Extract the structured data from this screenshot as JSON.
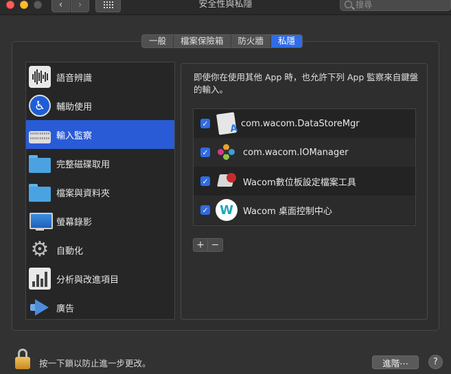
{
  "window": {
    "title": "安全性與私隱",
    "search_placeholder": "搜尋",
    "nav_back_glyph": "‹",
    "nav_forward_glyph": "›"
  },
  "tabs": [
    {
      "label": "一般",
      "active": false
    },
    {
      "label": "檔案保險箱",
      "active": false
    },
    {
      "label": "防火牆",
      "active": false
    },
    {
      "label": "私隱",
      "active": true
    }
  ],
  "sidebar": {
    "items": [
      {
        "label": "語音辨識",
        "icon": "speech-recognition-icon",
        "selected": false
      },
      {
        "label": "輔助使用",
        "icon": "accessibility-icon",
        "selected": false
      },
      {
        "label": "輸入監察",
        "icon": "keyboard-icon",
        "selected": true
      },
      {
        "label": "完整磁碟取用",
        "icon": "folder-icon",
        "selected": false
      },
      {
        "label": "檔案與資料夾",
        "icon": "folder-icon",
        "selected": false
      },
      {
        "label": "螢幕錄影",
        "icon": "display-icon",
        "selected": false
      },
      {
        "label": "自動化",
        "icon": "gear-icon",
        "selected": false
      },
      {
        "label": "分析與改進項目",
        "icon": "analytics-chart-icon",
        "selected": false
      },
      {
        "label": "廣告",
        "icon": "megaphone-icon",
        "selected": false
      }
    ]
  },
  "main": {
    "description": "即使你在使用其他 App 時，也允許下列 App 監察來自鍵盤的輸入。",
    "apps": [
      {
        "label": "com.wacom.DataStoreMgr",
        "checked": true,
        "icon": "app-document-icon"
      },
      {
        "label": "com.wacom.IOManager",
        "checked": true,
        "icon": "app-pinwheel-icon"
      },
      {
        "label": "Wacom數位板設定檔案工具",
        "checked": true,
        "icon": "tablet-utility-icon"
      },
      {
        "label": "Wacom 桌面控制中心",
        "checked": true,
        "icon": "wacom-logo-icon"
      }
    ],
    "add_label": "+",
    "remove_label": "−"
  },
  "footer": {
    "lock_text": "按一下鎖以防止進一步更改。",
    "advanced_label": "進階⋯",
    "help_label": "?"
  },
  "colors": {
    "accent": "#2f6ce5",
    "selected_row": "#2a5bd7",
    "background": "#323232"
  }
}
